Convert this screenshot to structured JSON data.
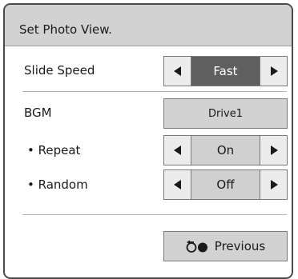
{
  "dialog": {
    "title": "Set Photo View."
  },
  "rows": {
    "slide_speed": {
      "label": "Slide Speed",
      "value": "Fast"
    },
    "bgm": {
      "label": "BGM",
      "value": "Drive1"
    },
    "repeat": {
      "label": "• Repeat",
      "value": "On"
    },
    "random": {
      "label": "• Random",
      "value": "Off"
    }
  },
  "footer": {
    "previous_label": "Previous"
  },
  "icons": {
    "left_arrow": "left-arrow-icon",
    "right_arrow": "right-arrow-icon",
    "back": "back-return-icon"
  },
  "colors": {
    "title_bar": "#d2d2d2",
    "selected_value": "#5f5f5f",
    "value_bg": "#d0d0d0",
    "border": "#4a4a4a"
  }
}
